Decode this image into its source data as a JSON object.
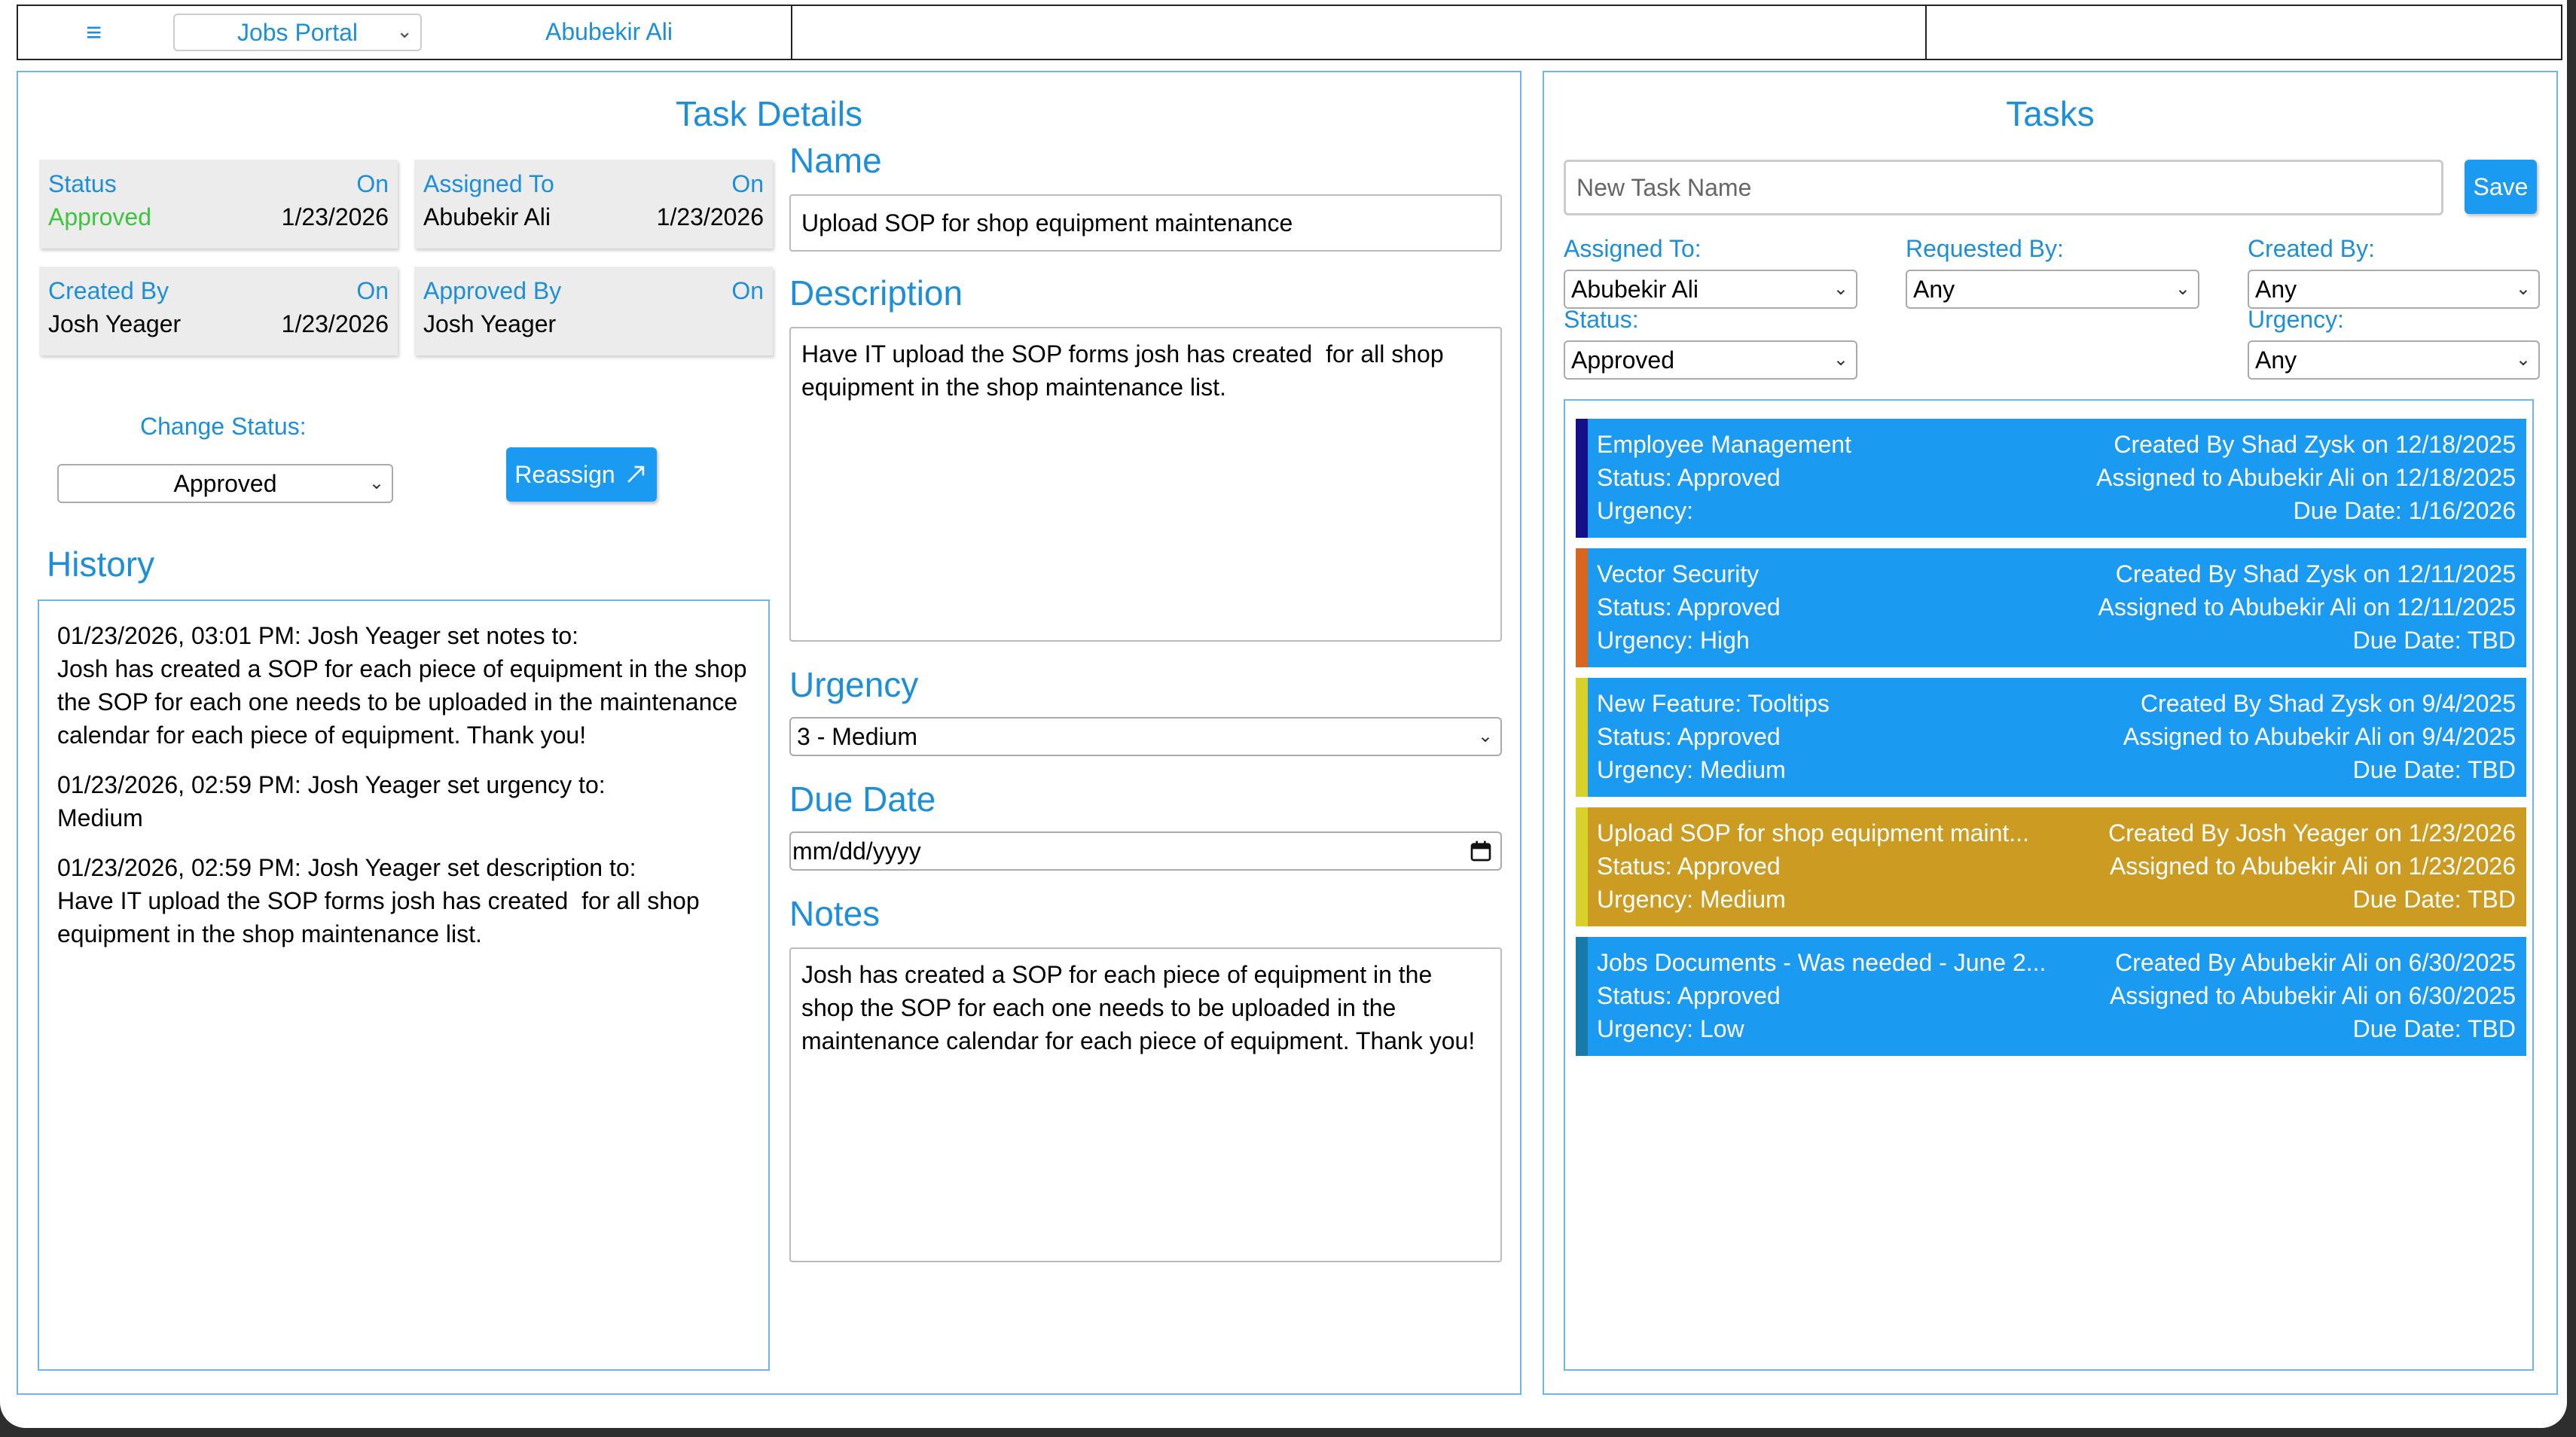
{
  "topbar": {
    "menu_glyph": "≡",
    "app_name": "Jobs Portal",
    "user": "Abubekir Ali"
  },
  "task_details": {
    "title": "Task Details",
    "cards": {
      "status": {
        "label": "Status",
        "on": "On",
        "value": "Approved",
        "date": "1/23/2026"
      },
      "assigned": {
        "label": "Assigned To",
        "on": "On",
        "value": "Abubekir Ali",
        "date": "1/23/2026"
      },
      "created": {
        "label": "Created By",
        "on": "On",
        "value": "Josh Yeager",
        "date": "1/23/2026"
      },
      "approved": {
        "label": "Approved By",
        "on": "On",
        "value": "Josh Yeager",
        "date": ""
      }
    },
    "change_status_label": "Change Status:",
    "change_status_value": "Approved",
    "reassign_label": "Reassign",
    "history_title": "History",
    "history": [
      "01/23/2026, 03:01 PM: Josh Yeager set notes to:\nJosh has created a SOP for each piece of equipment in the shop the SOP for each one needs to be uploaded in the maintenance calendar for each piece of equipment. Thank you!",
      "01/23/2026, 02:59 PM: Josh Yeager set urgency to:\nMedium",
      "01/23/2026, 02:59 PM: Josh Yeager set description to:\nHave IT upload the SOP forms josh has created  for all shop equipment in the shop maintenance list."
    ],
    "name_label": "Name",
    "name_value": "Upload SOP for shop equipment maintenance",
    "description_label": "Description",
    "description_value": "Have IT upload the SOP forms josh has created  for all shop equipment in the shop maintenance list.",
    "urgency_label": "Urgency",
    "urgency_value": "3 - Medium",
    "due_label": "Due Date",
    "due_placeholder": "mm/dd/yyyy",
    "notes_label": "Notes",
    "notes_value": "Josh has created a SOP for each piece of equipment in the shop the SOP for each one needs to be uploaded in the maintenance calendar for each piece of equipment. Thank you!"
  },
  "tasks": {
    "title": "Tasks",
    "new_task_placeholder": "New Task Name",
    "save_label": "Save",
    "filters": {
      "assigned_label": "Assigned To:",
      "assigned_value": "Abubekir Ali",
      "requested_label": "Requested By:",
      "requested_value": "Any",
      "created_label": "Created By:",
      "created_value": "Any",
      "status_label": "Status:",
      "status_value": "Approved",
      "urgency_label": "Urgency:",
      "urgency_value": "Any"
    },
    "items": [
      {
        "title": "Employee Management",
        "status": "Status: Approved",
        "urgency": "Urgency:",
        "created": "Created By Shad Zysk on 12/18/2025",
        "assigned": "Assigned to Abubekir Ali on 12/18/2025",
        "due": "Due Date: 1/16/2026",
        "bg": "#1a9af0",
        "bar": "#14108a"
      },
      {
        "title": "Vector Security",
        "status": "Status: Approved",
        "urgency": "Urgency: High",
        "created": "Created By Shad Zysk on 12/11/2025",
        "assigned": "Assigned to Abubekir Ali on 12/11/2025",
        "due": "Due Date: TBD",
        "bg": "#1a9af0",
        "bar": "#d9661e"
      },
      {
        "title": "New Feature: Tooltips",
        "status": "Status: Approved",
        "urgency": "Urgency: Medium",
        "created": "Created By Shad Zysk on 9/4/2025",
        "assigned": "Assigned to Abubekir Ali on 9/4/2025",
        "due": "Due Date: TBD",
        "bg": "#1a9af0",
        "bar": "#d7d12a"
      },
      {
        "title": "Upload SOP for shop equipment maint...",
        "status": "Status: Approved",
        "urgency": "Urgency: Medium",
        "created": "Created By Josh Yeager on 1/23/2026",
        "assigned": "Assigned to Abubekir Ali on 1/23/2026",
        "due": "Due Date: TBD",
        "bg": "#cc9c22",
        "bar": "#d7d12a"
      },
      {
        "title": "Jobs Documents - Was needed - June 2...",
        "status": "Status: Approved",
        "urgency": "Urgency: Low",
        "created": "Created By Abubekir Ali on 6/30/2025",
        "assigned": "Assigned to Abubekir Ali on 6/30/2025",
        "due": "Due Date: TBD",
        "bg": "#1a9af0",
        "bar": "#177aa8"
      }
    ]
  }
}
